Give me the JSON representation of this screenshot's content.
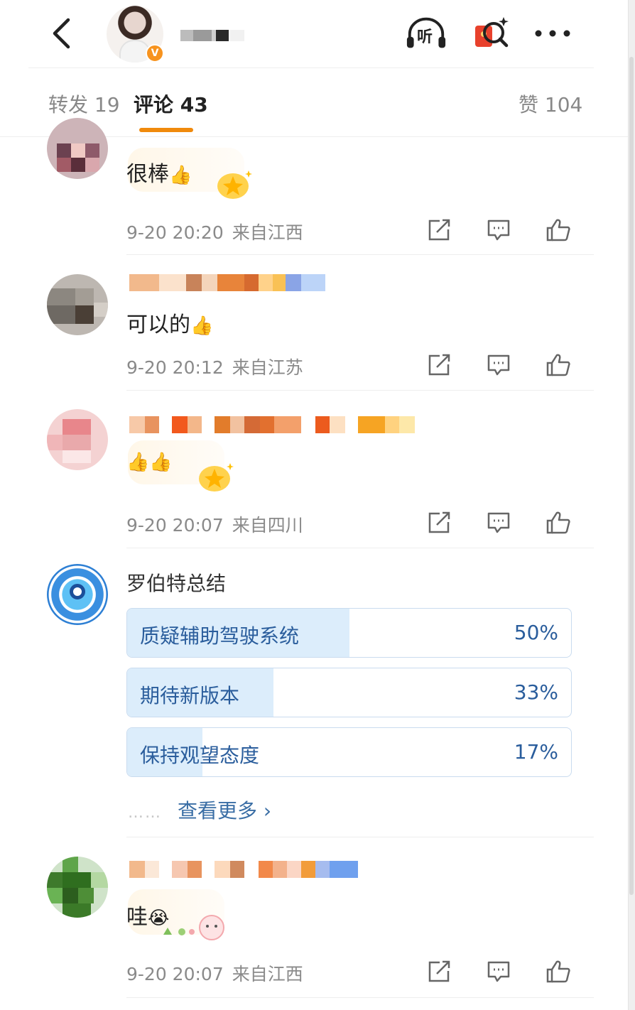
{
  "header": {
    "back_icon": "chevron-left-icon",
    "verified_badge": "V",
    "listen_label": "听",
    "icons": [
      "headphones-listen-icon",
      "redpacket-search-icon",
      "more-dots-icon"
    ]
  },
  "tabs": {
    "repost": "转发 19",
    "comments": "评论 43",
    "likes": "赞 104"
  },
  "comments": [
    {
      "text": "很棒",
      "emoji": "👍",
      "date": "9-20 20:20",
      "location": "来自江西"
    },
    {
      "text": "可以的",
      "emoji": "👍",
      "date": "9-20 20:12",
      "location": "来自江苏"
    },
    {
      "text": "",
      "emoji": "👍👍",
      "date": "9-20 20:07",
      "location": "来自四川"
    },
    {
      "text": "哇",
      "emoji": "😭",
      "date": "9-20 20:07",
      "location": "来自江西"
    }
  ],
  "poll": {
    "title": "罗伯特总结",
    "options": [
      {
        "label": "质疑辅助驾驶系统",
        "percent": "50%",
        "value": 50
      },
      {
        "label": "期待新版本",
        "percent": "33%",
        "value": 33
      },
      {
        "label": "保持观望态度",
        "percent": "17%",
        "value": 17
      }
    ],
    "more_dots": "……",
    "more_label": "查看更多 ›"
  },
  "action_icons": [
    "repost-icon",
    "comment-icon",
    "like-icon"
  ],
  "colors": {
    "accent": "#f08a0c",
    "poll_fill": "#dcedfb",
    "poll_text": "#2a5d9c",
    "meta_text": "#8a8a8a"
  }
}
